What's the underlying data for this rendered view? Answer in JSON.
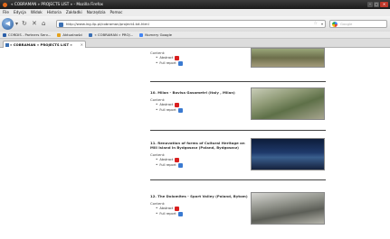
{
  "window": {
    "title": "« COBRAMAN » PROJECTS LIST » - Mozilla Firefox"
  },
  "menu": [
    "File",
    "Edycja",
    "Widok",
    "Historia",
    "Zakładki",
    "Narzędzia",
    "Pomoc"
  ],
  "toolbar": {
    "url": "http://www.ing.ilp.pl/cobraman/project4.txt.html",
    "search_placeholder": "Google"
  },
  "bookmarks": [
    {
      "label": "CORDIS - Partners Serv..."
    },
    {
      "label": "Aktualności"
    },
    {
      "label": "« COBRAMAN » PROJ..."
    },
    {
      "label": "Numery Google"
    }
  ],
  "tabs": [
    {
      "label": "« COBRAMAN » PROJECTS LIST »"
    }
  ],
  "projects": [
    {
      "title": "",
      "content_label": "Content:",
      "abstract_label": "Abstract",
      "fullreport_label": "Full report"
    },
    {
      "title": "10. Milan - Bovisa Gasometri (Italy , Milan)",
      "content_label": "Content:",
      "abstract_label": "Abstract",
      "fullreport_label": "Full report"
    },
    {
      "title": "11. Renovation of forms of Cultural Heritage on Mill Island in Bydgoszcz (Poland, Bydgoszcz)",
      "content_label": "Content:",
      "abstract_label": "Abstract",
      "fullreport_label": "Full report"
    },
    {
      "title": "12. The Dolomites - Sport Valley (Poland, Bytom)",
      "content_label": "Content:",
      "abstract_label": "Abstract",
      "fullreport_label": "Full report"
    }
  ]
}
